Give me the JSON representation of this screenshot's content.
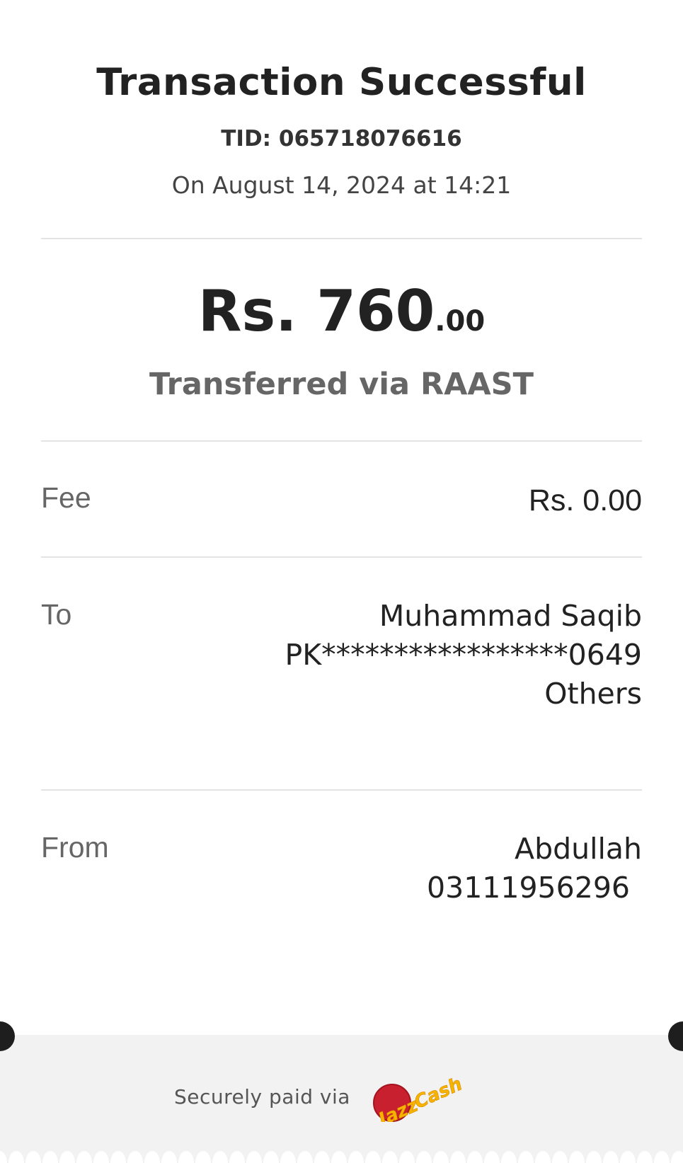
{
  "receipt": {
    "title": "Transaction Successful",
    "tid": "TID: 065718076616",
    "date": "On August 14, 2024 at 14:21",
    "amount_main": "Rs. 760",
    "amount_cents": ".00",
    "method": "Transferred via RAAST"
  },
  "details": {
    "fee_label": "Fee",
    "fee_value": "Rs. 0.00",
    "to_label": "To",
    "to_name": "Muhammad Saqib",
    "to_account": "PK*****************0649",
    "to_bank": "Others",
    "from_label": "From",
    "from_name": "Abdullah",
    "from_number": "03111956296"
  },
  "footer": {
    "secure_text": "Securely paid via",
    "logo_name": "JazzCash",
    "logo_icon": "jazzcash-logo",
    "background": "#f2f2f2",
    "notch_color": "#1e1e1e"
  }
}
